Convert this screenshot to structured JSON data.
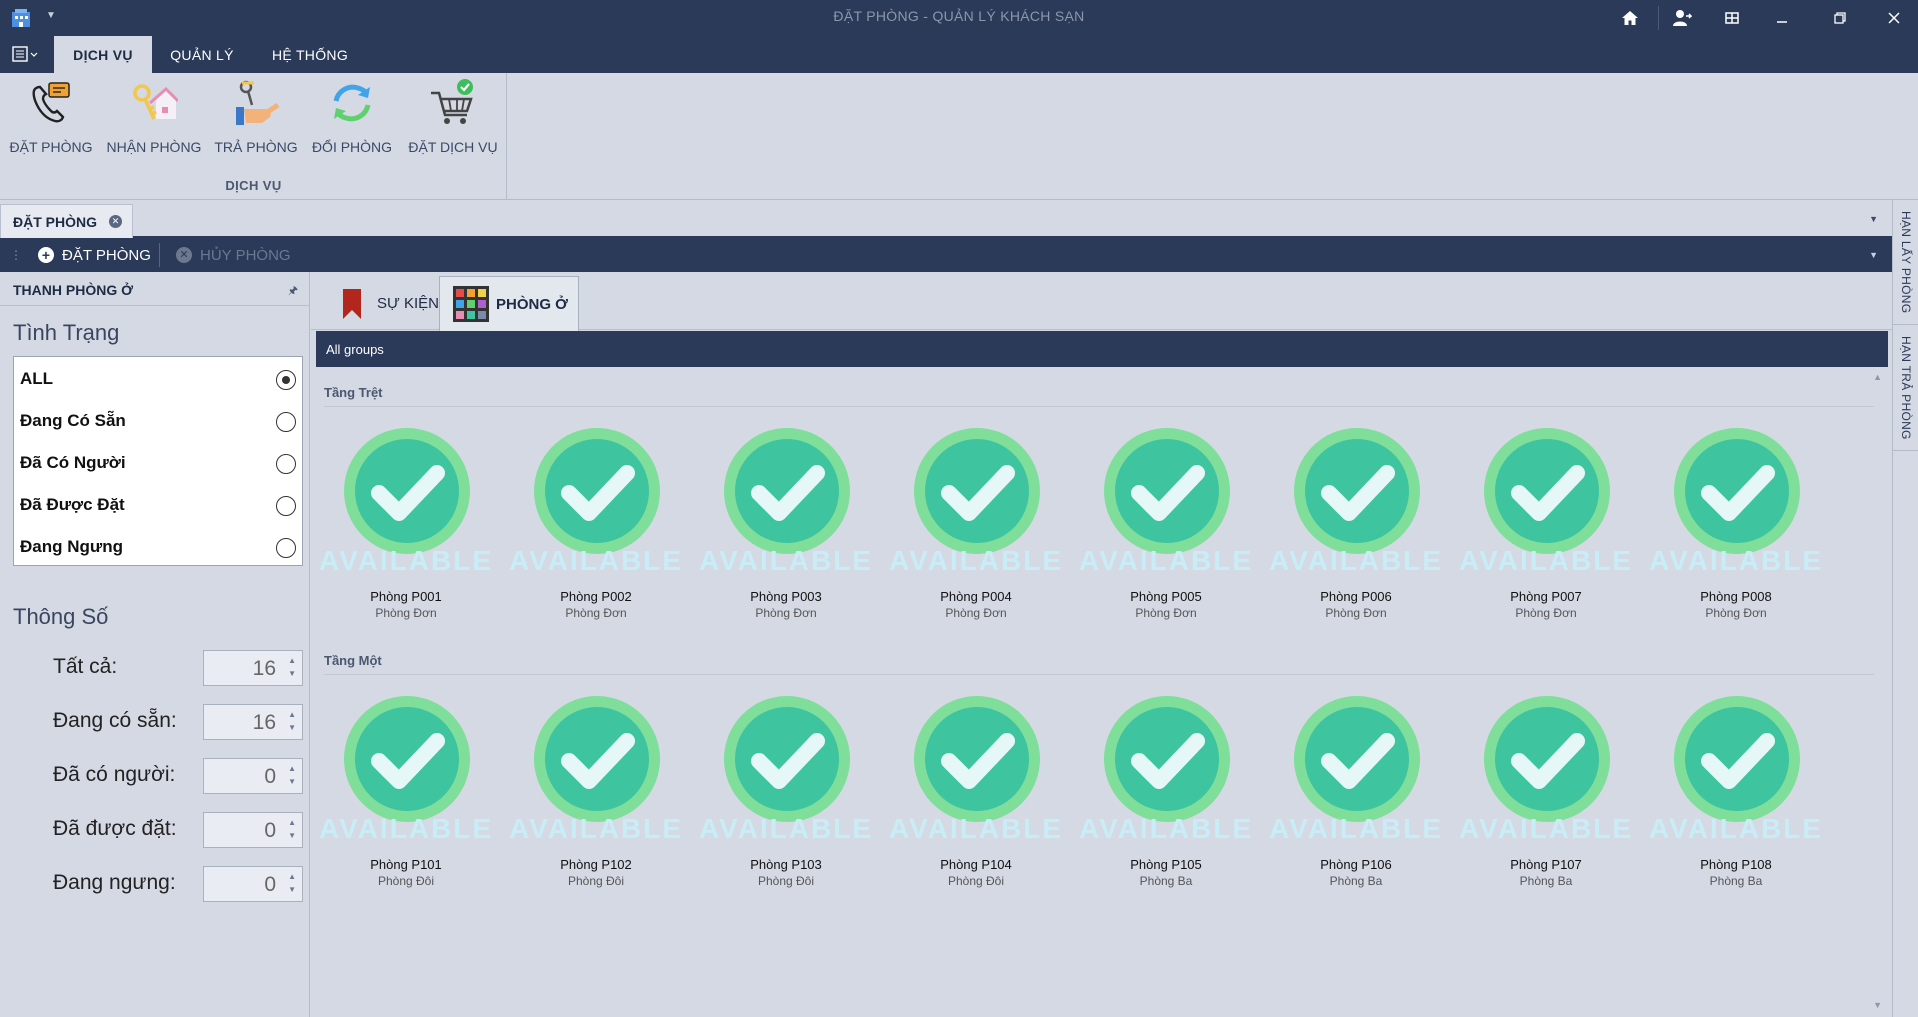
{
  "window": {
    "title": "ĐẶT PHÒNG - QUẢN LÝ KHÁCH SẠN",
    "buttons": [
      "home-icon",
      "user-switch-icon",
      "tile-icon",
      "minimize-icon",
      "restore-icon",
      "close-icon"
    ]
  },
  "ribbon": {
    "tabs": [
      {
        "label": "DỊCH VỤ",
        "active": true
      },
      {
        "label": "QUẢN LÝ",
        "active": false
      },
      {
        "label": "HỆ THỐNG",
        "active": false
      }
    ],
    "group_label": "DỊCH VỤ",
    "buttons": [
      {
        "label": "ĐẶT PHÒNG",
        "icon": "phone-booking-icon"
      },
      {
        "label": "NHẬN PHÒNG",
        "icon": "key-house-icon"
      },
      {
        "label": "TRẢ PHÒNG",
        "icon": "hand-key-icon"
      },
      {
        "label": "ĐỔI PHÒNG",
        "icon": "refresh-icon"
      },
      {
        "label": "ĐẶT DỊCH VỤ",
        "icon": "cart-check-icon"
      }
    ]
  },
  "document_tab": {
    "label": "ĐẶT PHÒNG"
  },
  "toolbar": {
    "book_label": "ĐẶT PHÒNG",
    "cancel_label": "HỦY PHÒNG"
  },
  "right_dock": {
    "tab1": "HẠN LẤY PHÒNG",
    "tab2": "HẠN TRẢ PHÒNG"
  },
  "left_panel": {
    "title": "THANH PHÒNG Ở",
    "status_title": "Tình Trạng",
    "status_options": [
      {
        "label": "ALL",
        "selected": true
      },
      {
        "label": "Đang Có Sẵn",
        "selected": false
      },
      {
        "label": "Đã Có Người",
        "selected": false
      },
      {
        "label": "Đã Được Đặt",
        "selected": false
      },
      {
        "label": "Đang Ngưng",
        "selected": false
      }
    ],
    "stats_title": "Thông Số",
    "stats": [
      {
        "label": "Tất cả:",
        "value": "16"
      },
      {
        "label": "Đang có sẵn:",
        "value": "16"
      },
      {
        "label": "Đã có người:",
        "value": "0"
      },
      {
        "label": "Đã được đặt:",
        "value": "0"
      },
      {
        "label": "Đang ngưng:",
        "value": "0"
      }
    ]
  },
  "view_tabs": [
    {
      "label": "SỰ KIỆN",
      "icon": "bookmark-icon",
      "active": false
    },
    {
      "label": "PHÒNG Ở",
      "icon": "grid-colors-icon",
      "active": true
    }
  ],
  "group_bar": "All groups",
  "floors": [
    {
      "name": "Tầng Trệt",
      "rooms": [
        {
          "name": "Phòng P001",
          "type": "Phòng Đơn",
          "status": "AVAILABLE"
        },
        {
          "name": "Phòng P002",
          "type": "Phòng Đơn",
          "status": "AVAILABLE"
        },
        {
          "name": "Phòng P003",
          "type": "Phòng Đơn",
          "status": "AVAILABLE"
        },
        {
          "name": "Phòng P004",
          "type": "Phòng Đơn",
          "status": "AVAILABLE"
        },
        {
          "name": "Phòng P005",
          "type": "Phòng Đơn",
          "status": "AVAILABLE"
        },
        {
          "name": "Phòng P006",
          "type": "Phòng Đơn",
          "status": "AVAILABLE"
        },
        {
          "name": "Phòng P007",
          "type": "Phòng Đơn",
          "status": "AVAILABLE"
        },
        {
          "name": "Phòng P008",
          "type": "Phòng Đơn",
          "status": "AVAILABLE"
        }
      ]
    },
    {
      "name": "Tầng Một",
      "rooms": [
        {
          "name": "Phòng P101",
          "type": "Phòng Đôi",
          "status": "AVAILABLE"
        },
        {
          "name": "Phòng P102",
          "type": "Phòng Đôi",
          "status": "AVAILABLE"
        },
        {
          "name": "Phòng P103",
          "type": "Phòng Đôi",
          "status": "AVAILABLE"
        },
        {
          "name": "Phòng P104",
          "type": "Phòng Đôi",
          "status": "AVAILABLE"
        },
        {
          "name": "Phòng P105",
          "type": "Phòng Ba",
          "status": "AVAILABLE"
        },
        {
          "name": "Phòng P106",
          "type": "Phòng Ba",
          "status": "AVAILABLE"
        },
        {
          "name": "Phòng P107",
          "type": "Phòng Ba",
          "status": "AVAILABLE"
        },
        {
          "name": "Phòng P108",
          "type": "Phòng Ba",
          "status": "AVAILABLE"
        }
      ]
    }
  ],
  "colors": {
    "titlebar": "#2a3a58",
    "panel_bg": "#d4d9e4",
    "badge_outer": "#7ede9a",
    "badge_inner": "#3fc4a0",
    "check": "#e6f7f8",
    "available_text": "#c9edf7"
  }
}
